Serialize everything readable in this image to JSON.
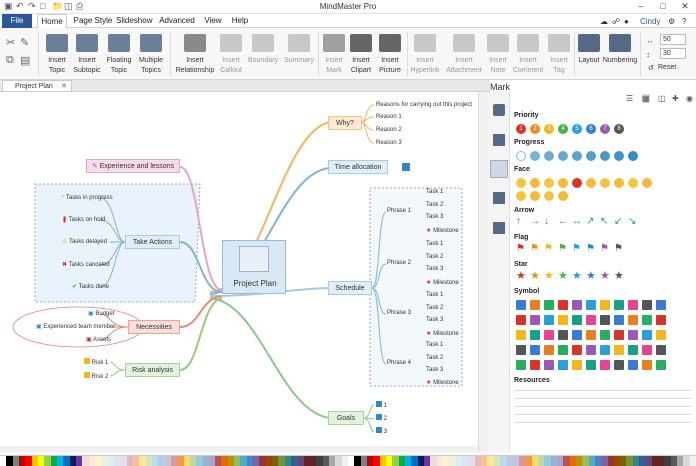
{
  "app": {
    "title": "MindMaster Pro",
    "user": "Cindy"
  },
  "menu": {
    "tabs": [
      "File",
      "Home",
      "Page Style",
      "Slideshow",
      "Advanced",
      "View",
      "Help"
    ]
  },
  "ribbon": {
    "buttons": [
      {
        "label": "Insert\nTopic",
        "dis": false
      },
      {
        "label": "Insert\nSubtopic",
        "dis": false
      },
      {
        "label": "Floating\nTopic",
        "dis": false
      },
      {
        "label": "Multiple\nTopics",
        "dis": false
      },
      {
        "label": "Insert\nRelationship",
        "dis": false
      },
      {
        "label": "Insert\nCallout",
        "dis": true
      },
      {
        "label": "Boundary",
        "dis": true
      },
      {
        "label": "Summary",
        "dis": true
      },
      {
        "label": "Insert\nMark",
        "dis": true
      },
      {
        "label": "Insert\nClipart",
        "dis": false
      },
      {
        "label": "Insert\nPicture",
        "dis": false
      },
      {
        "label": "Insert\nHyperlink",
        "dis": true
      },
      {
        "label": "Insert\nAttachment",
        "dis": true
      },
      {
        "label": "Insert\nNote",
        "dis": true
      },
      {
        "label": "Insert\nComment",
        "dis": true
      },
      {
        "label": "Insert\nTag",
        "dis": true
      },
      {
        "label": "Layout",
        "dis": false
      },
      {
        "label": "Numbering",
        "dis": false
      }
    ],
    "size1": "50",
    "size2": "30",
    "reset": "Reset"
  },
  "doc": {
    "tab": "Project Plan"
  },
  "map": {
    "center": "Project Plan",
    "why": "Why?",
    "why_intro": "Reasons for carrying out this project",
    "reasons": [
      "Reason 1",
      "Reason 2",
      "Reason 3"
    ],
    "time": "Time allocation",
    "schedule": "Schedule",
    "phases": [
      "Phrase 1",
      "Phrase 2",
      "Phrase 3",
      "Phrase 4"
    ],
    "tasks": [
      "Task 1",
      "Task 2",
      "Task 3"
    ],
    "milestone": "Milestone",
    "goals": "Goals",
    "goal_items": [
      "1",
      "2",
      "3"
    ],
    "experience": "Experience and lessons",
    "actions": "Take Actions",
    "action_items": [
      "Tasks in progress",
      "Tasks on hold",
      "Tasks delayed",
      "Tasks canceled",
      "Tasks done"
    ],
    "necessities": "Necessities",
    "necessity_items": [
      "Budget",
      "Experienced team member",
      "Assets"
    ],
    "risk": "Risk analysis",
    "risk_items": [
      "Risk 1",
      "Risk 2"
    ]
  },
  "panel": {
    "title": "Mark",
    "sections": [
      "Priority",
      "Progress",
      "Face",
      "Arrow",
      "Flag",
      "Star",
      "Symbol",
      "Resources"
    ],
    "priority": [
      "1",
      "2",
      "3",
      "4",
      "5",
      "6",
      "7",
      "8"
    ],
    "priority_colors": [
      "#d9342b",
      "#f08a24",
      "#f3b71d",
      "#4caf50",
      "#29a0d8",
      "#3a7bd5",
      "#9b59b6",
      "#555555"
    ]
  },
  "colors": {
    "accent": "#2b5797"
  }
}
